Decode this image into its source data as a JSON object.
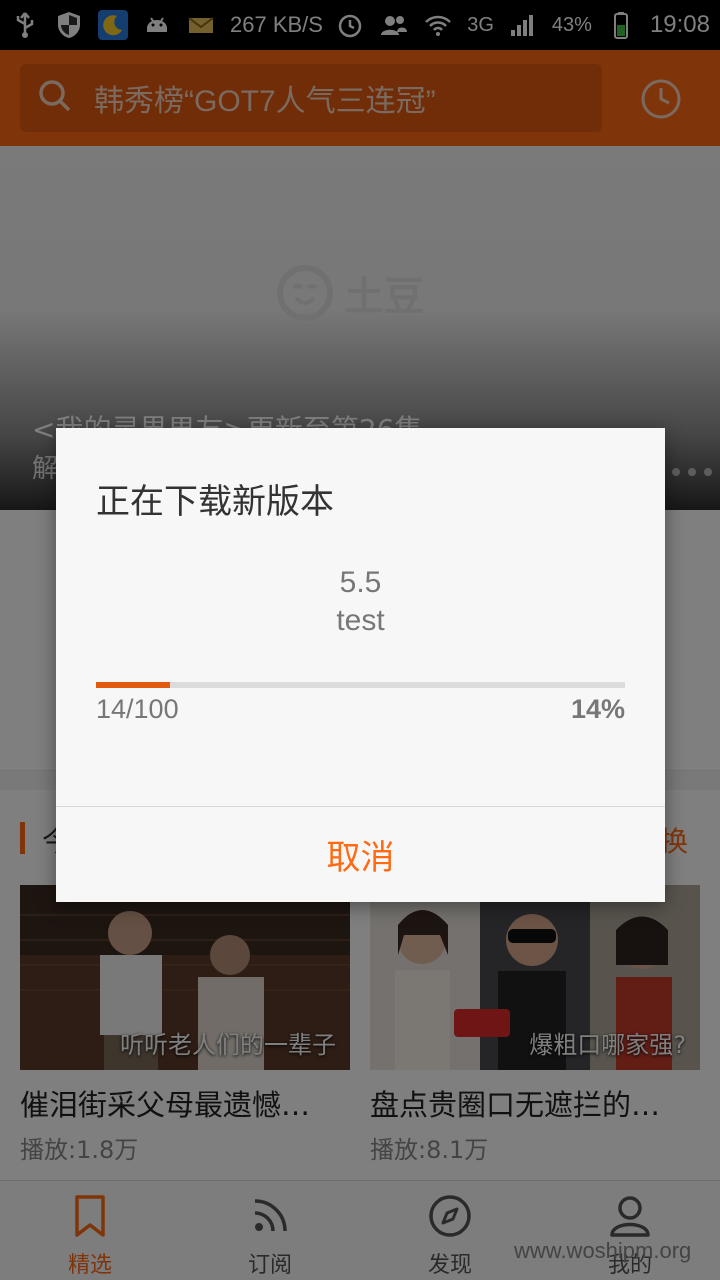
{
  "status_bar": {
    "network_speed": "267 KB/S",
    "network_type": "3G",
    "battery_percent": "43%",
    "time": "19:08",
    "icons": [
      "usb-icon",
      "shield-icon",
      "moon-icon",
      "android-icon",
      "mail-icon",
      "wifi-icon",
      "alarm-icon",
      "contacts-icon",
      "signal-icon",
      "battery-icon"
    ]
  },
  "header": {
    "search_placeholder": "韩秀榜“GOT7人气三连冠”",
    "icons": [
      "search-icon",
      "clock-icon"
    ],
    "accent_color": "#ff6a13"
  },
  "banner": {
    "logo_text": "土豆",
    "title": "<我的灵界男友>更新至第26集",
    "subtitle": "解"
  },
  "section": {
    "title": "今",
    "more_label": "换"
  },
  "videos": [
    {
      "caption": "听听老人们的一辈子",
      "title": "催泪街采父母最遗憾…",
      "plays": "播放:1.8万"
    },
    {
      "caption": "爆粗口哪家强?",
      "title": "盘点贵圈口无遮拦的…",
      "plays": "播放:8.1万"
    }
  ],
  "bottom_nav": [
    {
      "label": "精选",
      "icon": "bookmark-icon",
      "active": true
    },
    {
      "label": "订阅",
      "icon": "rss-icon",
      "active": false
    },
    {
      "label": "发现",
      "icon": "compass-icon",
      "active": false
    },
    {
      "label": "我的",
      "icon": "person-icon",
      "active": false
    }
  ],
  "watermark": "www.woshipm.org",
  "dialog": {
    "title": "正在下载新版本",
    "version": "5.5",
    "version_note": "test",
    "progress_count": "14/100",
    "progress_percent": "14%",
    "progress_value": 0.14,
    "cancel_label": "取消"
  }
}
